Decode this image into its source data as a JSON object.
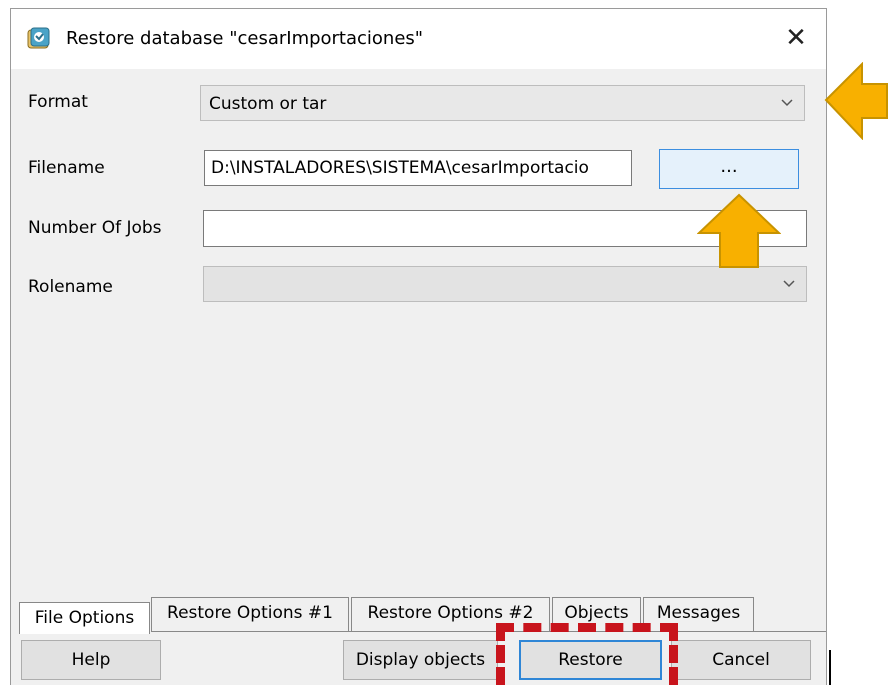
{
  "dialog": {
    "title": "Restore database \"cesarImportaciones\"",
    "app_icon": "pgadmin-elephant-icon",
    "close_glyph": "✕"
  },
  "form": {
    "format_label": "Format",
    "format_value": "Custom or tar",
    "filename_label": "Filename",
    "filename_value": "D:\\INSTALADORES\\SISTEMA\\cesarImportacio",
    "browse_label": "...",
    "jobs_label": "Number Of Jobs",
    "jobs_value": "",
    "rolename_label": "Rolename",
    "rolename_value": ""
  },
  "tabs": [
    {
      "label": "File Options",
      "active": true
    },
    {
      "label": "Restore Options #1"
    },
    {
      "label": "Restore Options #2"
    },
    {
      "label": "Objects"
    },
    {
      "label": "Messages"
    }
  ],
  "buttons": {
    "help": "Help",
    "display_objects": "Display objects",
    "restore": "Restore",
    "cancel": "Cancel"
  },
  "annotations": {
    "arrow_color": "#f8b000",
    "arrow_outline": "#c89300",
    "highlight_color": "#c8141c",
    "focus_color": "#2f86d6"
  }
}
